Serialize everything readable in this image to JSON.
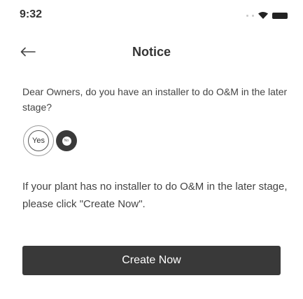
{
  "status_bar": {
    "time": "9:32",
    "icons": [
      "signal-dots-icon",
      "wifi-icon",
      "battery-icon"
    ]
  },
  "nav": {
    "title": "Notice",
    "back_icon": "arrow-left-icon"
  },
  "question": "Dear Owners, do you have an installer to do O&M in the later stage?",
  "choices": {
    "yes_label": "Yes",
    "no_label": "No"
  },
  "hint": "If your plant has no installer to do O&M in the later stage, please click \"Create Now\".",
  "create_button": {
    "label": "Create Now",
    "background": "#393939"
  }
}
